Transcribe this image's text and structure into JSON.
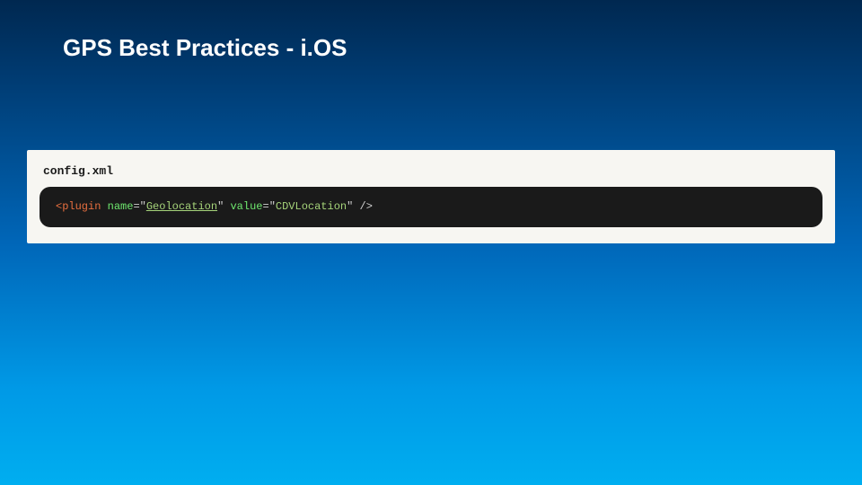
{
  "slide": {
    "title": "GPS Best Practices - i.OS"
  },
  "codePanel": {
    "fileLabel": "config.xml",
    "code": {
      "tagOpen": "<plugin",
      "attr1Name": "name",
      "eq": "=",
      "quote": "\"",
      "attr1Value": "Geolocation",
      "attr2Name": "value",
      "attr2Value": "CDVLocation",
      "tagClose": "/>"
    }
  }
}
